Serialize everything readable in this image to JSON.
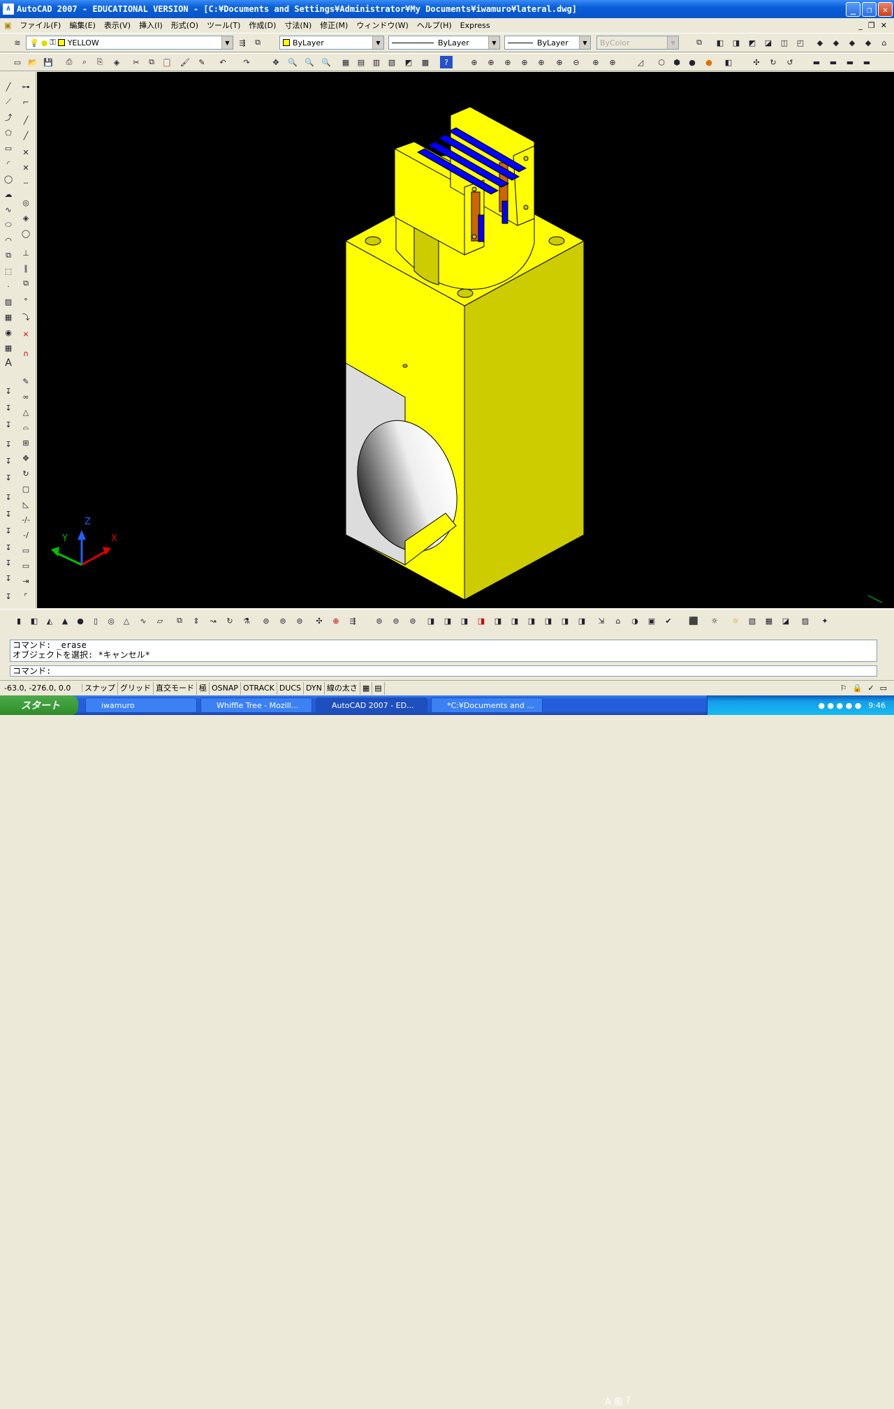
{
  "window": {
    "title": "AutoCAD 2007 - EDUCATIONAL VERSION - [C:¥Documents and Settings¥Administrator¥My Documents¥iwamuro¥lateral.dwg]",
    "app_icon": "A"
  },
  "menu": {
    "items": [
      "ファイル(F)",
      "編集(E)",
      "表示(V)",
      "挿入(I)",
      "形式(O)",
      "ツール(T)",
      "作成(D)",
      "寸法(N)",
      "修正(M)",
      "ウィンドウ(W)",
      "ヘルプ(H)",
      "Express"
    ]
  },
  "layers": {
    "current_layer": "YELLOW",
    "color": "ByLayer",
    "linetype": "ByLayer",
    "lineweight": "ByLayer",
    "plotstyle": "ByColor"
  },
  "command": {
    "history_line1": "コマンド: _erase",
    "history_line2": "オブジェクトを選択: *キャンセル*",
    "prompt": "コマンド:"
  },
  "status": {
    "coords": "-63.0,  -276.0, 0.0",
    "buttons": [
      "スナップ",
      "グリッド",
      "直交モード",
      "極",
      "OSNAP",
      "OTRACK",
      "DUCS",
      "DYN",
      "線の太さ"
    ]
  },
  "viewport": {
    "ucs_x": "X",
    "ucs_y": "Y",
    "ucs_z": "Z",
    "model_color": "#ffff00",
    "background": "#000000"
  },
  "taskbar": {
    "start": "スタート",
    "tasks": [
      "iwamuro",
      "Whiffle Tree - Mozill...",
      "AutoCAD 2007 - ED...",
      "*C:¥Documents and ..."
    ],
    "ime_text": "A 般",
    "clock": "9:46"
  }
}
